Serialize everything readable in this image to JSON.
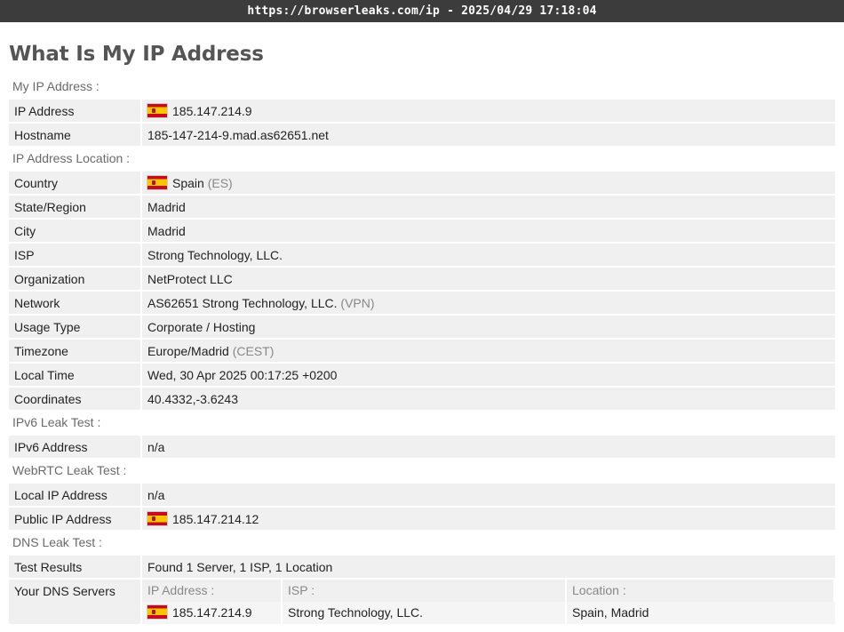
{
  "window": {
    "title": "https://browserleaks.com/ip - 2025/04/29 17:18:04"
  },
  "page": {
    "title": "What Is My IP Address"
  },
  "flag_colors": {
    "red": "#c60b1e",
    "yellow": "#ffc400"
  },
  "sections": {
    "my_ip": {
      "title": "My IP Address :",
      "ip_address": {
        "label": "IP Address",
        "value": "185.147.214.9"
      },
      "hostname": {
        "label": "Hostname",
        "value": "185-147-214-9.mad.as62651.net"
      }
    },
    "location": {
      "title": "IP Address Location :",
      "country": {
        "label": "Country",
        "value": "Spain",
        "extra": "(ES)"
      },
      "state": {
        "label": "State/Region",
        "value": "Madrid"
      },
      "city": {
        "label": "City",
        "value": "Madrid"
      },
      "isp": {
        "label": "ISP",
        "value": "Strong Technology, LLC."
      },
      "organization": {
        "label": "Organization",
        "value": "NetProtect LLC"
      },
      "network": {
        "label": "Network",
        "value": "AS62651 Strong Technology, LLC.",
        "extra": "(VPN)"
      },
      "usage_type": {
        "label": "Usage Type",
        "value": "Corporate / Hosting"
      },
      "timezone": {
        "label": "Timezone",
        "value": "Europe/Madrid",
        "extra": "(CEST)"
      },
      "local_time": {
        "label": "Local Time",
        "value": "Wed, 30 Apr 2025 00:17:25 +0200"
      },
      "coordinates": {
        "label": "Coordinates",
        "value": "40.4332,-3.6243"
      }
    },
    "ipv6": {
      "title": "IPv6 Leak Test :",
      "ipv6_address": {
        "label": "IPv6 Address",
        "value": "n/a"
      }
    },
    "webrtc": {
      "title": "WebRTC Leak Test :",
      "local_ip": {
        "label": "Local IP Address",
        "value": "n/a"
      },
      "public_ip": {
        "label": "Public IP Address",
        "value": "185.147.214.12"
      }
    },
    "dns": {
      "title": "DNS Leak Test :",
      "test_results": {
        "label": "Test Results",
        "value": "Found 1 Server, 1 ISP, 1 Location"
      },
      "servers": {
        "label": "Your DNS Servers",
        "headers": {
          "ip": "IP Address :",
          "isp": "ISP :",
          "location": "Location :"
        },
        "rows": [
          {
            "ip": "185.147.214.9",
            "isp": "Strong Technology, LLC.",
            "location": "Spain, Madrid"
          }
        ]
      }
    }
  }
}
